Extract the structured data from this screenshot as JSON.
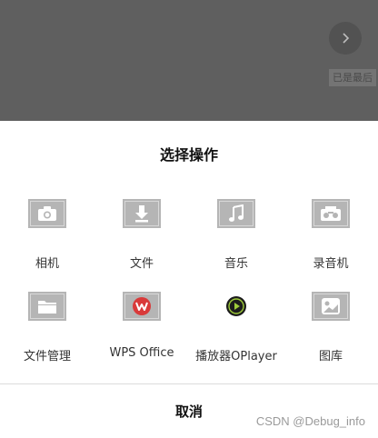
{
  "background": {
    "hint": "已是最后"
  },
  "sheet": {
    "title": "选择操作",
    "cancel_label": "取消",
    "items": [
      {
        "label": "相机",
        "icon": "camera-icon"
      },
      {
        "label": "文件",
        "icon": "download-icon"
      },
      {
        "label": "音乐",
        "icon": "music-note-icon"
      },
      {
        "label": "录音机",
        "icon": "recorder-icon"
      },
      {
        "label": "文件管理",
        "icon": "folder-icon"
      },
      {
        "label": "WPS Office",
        "icon": "wps-icon"
      },
      {
        "label": "播放器OPlayer",
        "icon": "play-icon"
      },
      {
        "label": "图库",
        "icon": "gallery-icon"
      }
    ]
  },
  "watermark": "CSDN @Debug_info",
  "colors": {
    "overlay": "#5f5f5f",
    "wps_red": "#d93a3a",
    "player_green": "#9ecb3a"
  }
}
